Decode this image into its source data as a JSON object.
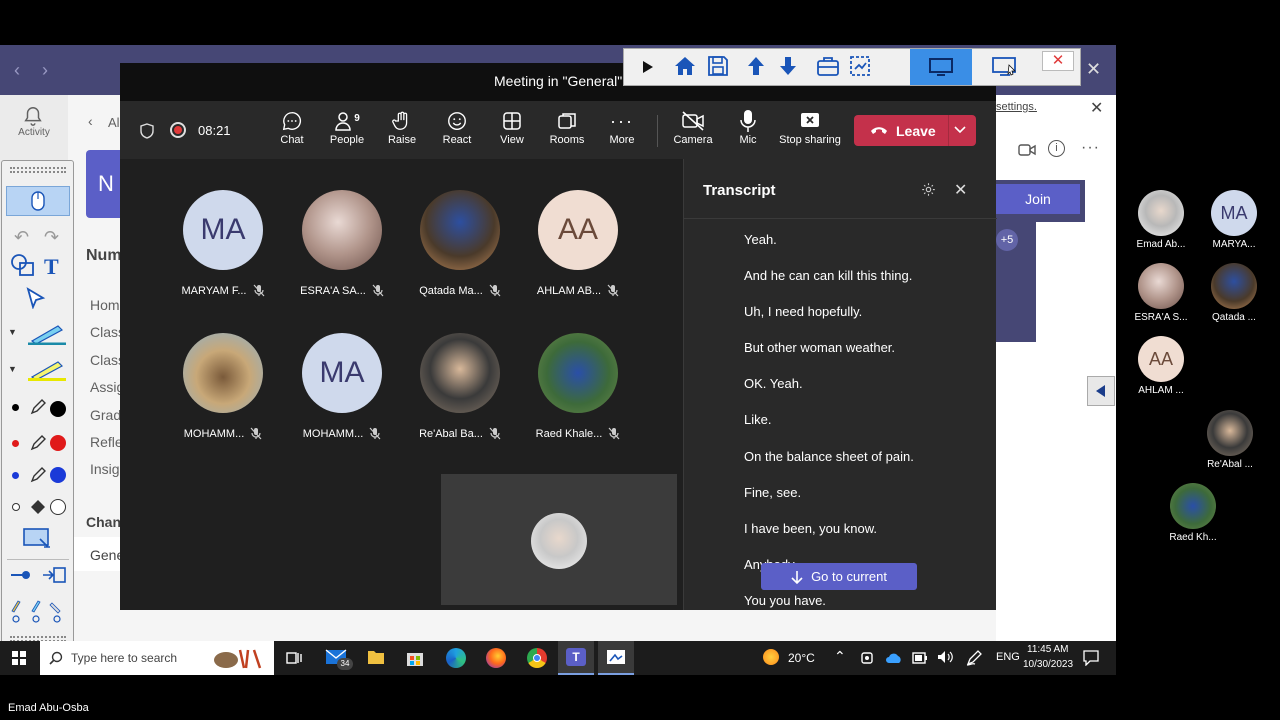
{
  "meeting": {
    "title": "Meeting in \"General\"",
    "timer": "08:21",
    "people_count": "9"
  },
  "toolbar": {
    "chat": "Chat",
    "people": "People",
    "raise": "Raise",
    "react": "React",
    "view": "View",
    "rooms": "Rooms",
    "more": "More",
    "camera": "Camera",
    "mic": "Mic",
    "stop_sharing": "Stop sharing",
    "leave": "Leave"
  },
  "participants": [
    {
      "name": "MARYAM F...",
      "initials": "MA"
    },
    {
      "name": "ESRA'A SA...",
      "initials": ""
    },
    {
      "name": "Qatada Ma...",
      "initials": ""
    },
    {
      "name": "AHLAM AB...",
      "initials": "AA"
    },
    {
      "name": "MOHAMM...",
      "initials": ""
    },
    {
      "name": "MOHAMM...",
      "initials": "MA"
    },
    {
      "name": "Re'Abal Ba...",
      "initials": ""
    },
    {
      "name": "Raed Khale...",
      "initials": ""
    }
  ],
  "transcript": {
    "title": "Transcript",
    "lines": [
      "Yeah.",
      "And he can can kill this thing.",
      "Uh, I need hopefully.",
      "But other woman weather.",
      "OK. Yeah.",
      "Like.",
      "On the balance sheet of pain.",
      "Fine, see.",
      "I have been, you know.",
      "Anybody.",
      "You you have."
    ],
    "go_to_current": "Go to current"
  },
  "background": {
    "activity": "Activity",
    "back_label": "Al",
    "heading": "Num",
    "nav": [
      "Hom",
      "Class",
      "Class",
      "Assig",
      "Grad",
      "Refle",
      "Insig"
    ],
    "channels": "Chan",
    "general": "Gene",
    "settings_link": "settings.",
    "join": "Join",
    "plus": "+5",
    "tile_letter": "N"
  },
  "gallery": [
    {
      "name": "Emad Ab...",
      "initials": ""
    },
    {
      "name": "MARYA...",
      "initials": "MA"
    },
    {
      "name": "ESRA'A S...",
      "initials": ""
    },
    {
      "name": "Qatada ...",
      "initials": ""
    },
    {
      "name": "AHLAM ...",
      "initials": "AA"
    },
    {
      "name": "Re'Abal ...",
      "initials": ""
    },
    {
      "name": "Raed Kh...",
      "initials": ""
    }
  ],
  "taskbar": {
    "search_placeholder": "Type here to search",
    "badge": "34",
    "weather": "20°C",
    "lang": "ENG",
    "time": "11:45 AM",
    "date": "10/30/2023"
  },
  "presenter_label": "Emad Abu-Osba",
  "colors": {
    "teams_purple": "#464775",
    "leave_red": "#c4314b",
    "accent": "#5b5fc7"
  }
}
